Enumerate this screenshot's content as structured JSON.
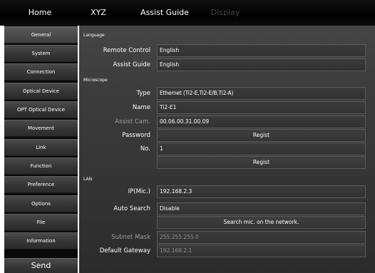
{
  "topnav": {
    "home": "Home",
    "xyz": "XYZ",
    "assist_guide": "Assist Guide",
    "display": "Display"
  },
  "sidebar": {
    "items": [
      {
        "label": "General",
        "active": true
      },
      {
        "label": "System"
      },
      {
        "label": "Connection"
      },
      {
        "label": "Optical Device"
      },
      {
        "label": "OPT Optical Device"
      },
      {
        "label": "Movement"
      },
      {
        "label": "Link"
      },
      {
        "label": "Function"
      },
      {
        "label": "Preference"
      },
      {
        "label": "Options"
      },
      {
        "label": "File"
      },
      {
        "label": "Information"
      }
    ],
    "send_label": "Send"
  },
  "language": {
    "title": "Language",
    "remote_control": {
      "label": "Remote Control",
      "value": "English"
    },
    "assist_guide": {
      "label": "Assist Guide",
      "value": "English"
    }
  },
  "microscope": {
    "title": "Microscope",
    "type": {
      "label": "Type",
      "value": "Ethernet (Ti2-E,Ti2-E/B,Ti2-A)"
    },
    "name": {
      "label": "Name",
      "value": "Ti2-E1"
    },
    "assist_cam": {
      "label": "Assist Cam.",
      "value": "00.06.00.31.00.09"
    },
    "password": {
      "label": "Password",
      "button": "Regist"
    },
    "no": {
      "label": "No.",
      "value": "1"
    },
    "regist_button": "Regist"
  },
  "lan": {
    "title": "LAN",
    "ip": {
      "label": "IP(Mic.)",
      "value": "192.168.2.3"
    },
    "auto_search": {
      "label": "Auto Search",
      "value": "Disable"
    },
    "search_button": "Search mic. on the network.",
    "subnet_mask": {
      "label": "Subnet Mask",
      "value": "255.255.255.0"
    },
    "default_gateway": {
      "label": "Default Gateway",
      "value": "192.168.2.1"
    }
  }
}
